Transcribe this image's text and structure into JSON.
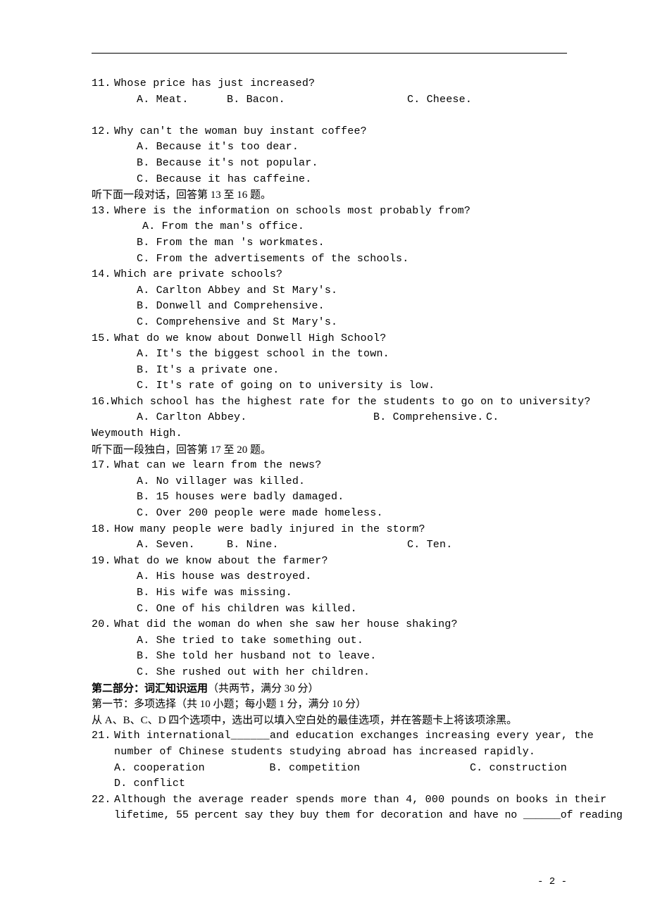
{
  "q11": {
    "num": "11.",
    "stem": "Whose price has just increased?",
    "A": "A. Meat.",
    "B": "B. Bacon.",
    "C": "C. Cheese."
  },
  "q12": {
    "num": "12.",
    "stem": "Why can't the woman buy instant coffee?",
    "A": "A. Because it's too dear.",
    "B": "B. Because it's not popular.",
    "C": "C. Because it has caffeine."
  },
  "sec13_16": "听下面一段对话，回答第 13 至 16 题。",
  "q13": {
    "num": "13.",
    "stem": "Where is the information on schools most probably from?",
    "A": "A. From the man's office.",
    "B": "B. From the man 's workmates.",
    "C": "C. From the advertisements of the schools."
  },
  "q14": {
    "num": "14.",
    "stem": "Which are private schools?",
    "A": "A. Carlton Abbey and St Mary's.",
    "B": "B. Donwell and Comprehensive.",
    "C": "C. Comprehensive and St Mary's."
  },
  "q15": {
    "num": "15.",
    "stem": "What do we know about Donwell High School?",
    "A": "A. It's the biggest school in the town.",
    "B": "B. It's a private one.",
    "C": "C. It's rate of going on to university is low."
  },
  "q16": {
    "num": "16.",
    "stem": "Which school has the highest rate for the students to go on to university?",
    "A": "A. Carlton Abbey.",
    "B": "B. Comprehensive.",
    "C": "C."
  },
  "q16_wrap": "Weymouth High.",
  "sec17_20": "听下面一段独白，回答第 17 至 20 题。",
  "q17": {
    "num": "17.",
    "stem": "What can we learn from the news?",
    "A": "A. No villager was killed.",
    "B": "B. 15 houses were badly damaged.",
    "C": "C. Over 200 people were made homeless."
  },
  "q18": {
    "num": "18.",
    "stem": "How many people were badly injured in the storm?",
    "A": "A. Seven.",
    "B": "B. Nine.",
    "C": "C. Ten."
  },
  "q19": {
    "num": "19.",
    "stem": "What do we know about the farmer?",
    "A": "A. His house was destroyed.",
    "B": "B. His wife was missing.",
    "C": "C. One of his children was killed."
  },
  "q20": {
    "num": "20.",
    "stem": "What did the woman do when she saw her house shaking?",
    "A": "A. She tried to take something out.",
    "B": "B.  She told her husband not to leave.",
    "C": "C. She rushed out with her children."
  },
  "part2_title_a": "第二部分：词汇知识运用",
  "part2_title_b": "（共两节，满分 30 分）",
  "part2_sub": "第一节：多项选择（共 10 小题；每小题 1 分，满分 10 分）",
  "part2_instr": "从 A、B、C、D 四个选项中，选出可以填入空白处的最佳选项，并在答题卡上将该项涂黑。",
  "q21": {
    "num": "21.",
    "l1a": "With international ",
    "l1b": " and education exchanges increasing every year, the",
    "l2": "number of Chinese students studying abroad has increased rapidly.",
    "A": "A. cooperation",
    "B": "B. competition",
    "C": "C.  construction",
    "D": "D. conflict"
  },
  "q22": {
    "num": "22.",
    "l1": "Although the average reader spends more than 4, 000 pounds on books in their",
    "l2a": "lifetime, 55 percent say they buy them for decoration and have no ",
    "l2b": "of reading"
  },
  "blank": "______",
  "footer": "- 2 -"
}
